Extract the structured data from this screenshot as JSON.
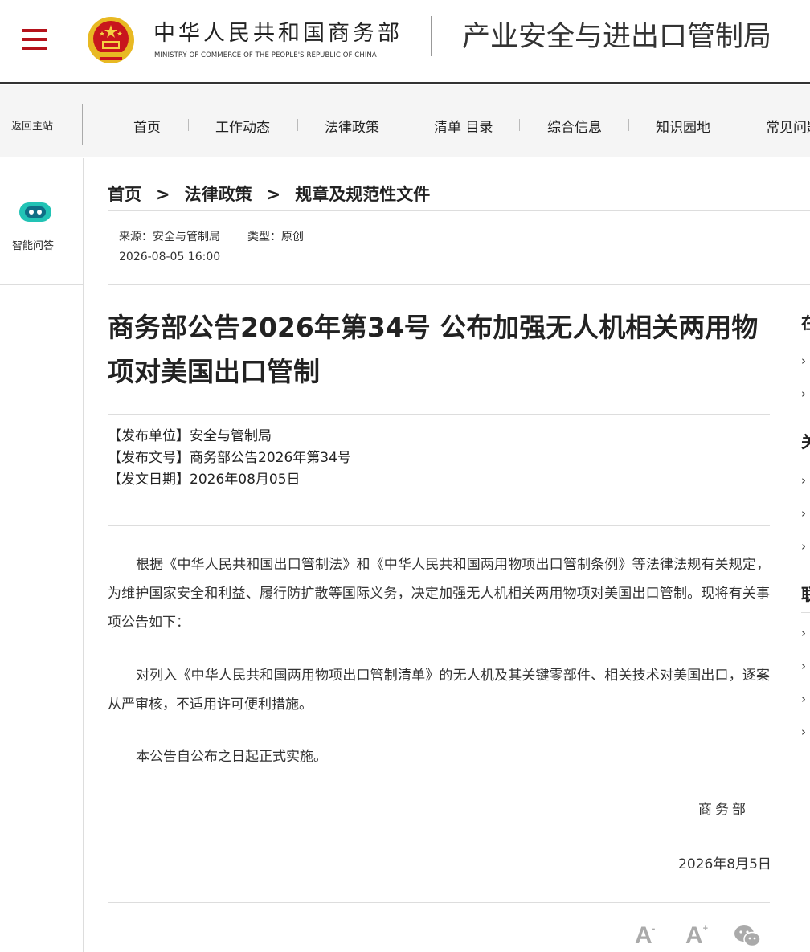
{
  "header": {
    "ministry_cn": "中华人民共和国商务部",
    "ministry_en": "MINISTRY OF COMMERCE OF THE PEOPLE'S REPUBLIC OF CHINA",
    "bureau": "产业安全与进出口管制局",
    "brand_color": "#b5121b"
  },
  "nav": {
    "back_home": "返回主站",
    "items": [
      "首页",
      "工作动态",
      "法律政策",
      "清单 目录",
      "综合信息",
      "知识园地",
      "常见问题"
    ]
  },
  "left_rail": {
    "qa_label": "智能问答",
    "icon": "robot-icon"
  },
  "breadcrumb": {
    "items": [
      "首页",
      "法律政策",
      "规章及规范性文件"
    ],
    "separator": ">"
  },
  "meta": {
    "source": "来源：安全与管制局",
    "type": "类型：原创",
    "datetime": "2026-08-05 16:00"
  },
  "article": {
    "title": "商务部公告2026年第34号 公布加强无人机相关两用物项对美国出口管制",
    "publisher": "【发布单位】安全与管制局",
    "doc_no": "【发布文号】商务部公告2026年第34号",
    "issue_date": "【发文日期】2026年08月05日",
    "paragraphs": [
      "根据《中华人民共和国出口管制法》和《中华人民共和国两用物项出口管制条例》等法律法规有关规定，为维护国家安全和利益、履行防扩散等国际义务，决定加强无人机相关两用物项对美国出口管制。现将有关事项公告如下：",
      "对列入《中华人民共和国两用物项出口管制清单》的无人机及其关键零部件、相关技术对美国出口，逐案从严审核，不适用许可便利措施。",
      "本公告自公布之日起正式实施。"
    ],
    "signature": "商务部",
    "sign_date": "2026年8月5日"
  },
  "tools": {
    "font_small": "A",
    "font_large": "A",
    "small_mark": "-",
    "large_mark": "+",
    "share_icon": "wechat-icon"
  },
  "right_column": {
    "headings": [
      "在",
      "关",
      "联"
    ],
    "arrow": "›"
  }
}
